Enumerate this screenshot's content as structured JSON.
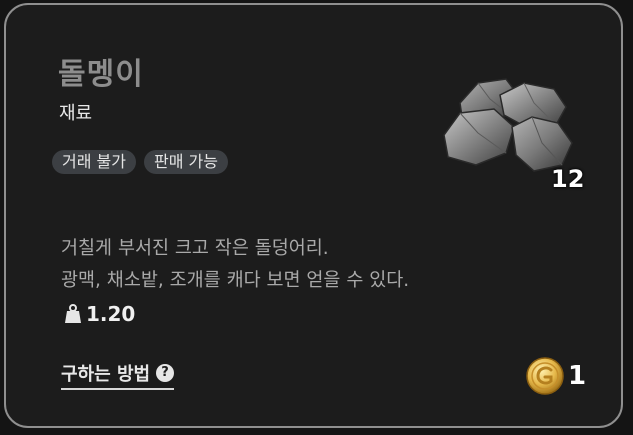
{
  "item": {
    "name": "돌멩이",
    "category": "재료",
    "tags": [
      "거래 불가",
      "판매 가능"
    ],
    "quantity": "12",
    "description_lines": [
      "거칠게 부서진 크고 작은 돌덩어리.",
      "광맥, 채소밭, 조개를 캐다 보면 얻을 수 있다."
    ],
    "weight": "1.20",
    "weight_icon": "weight-icon",
    "howto_label": "구하는 방법",
    "help_icon": "question-circle-icon",
    "price": "1",
    "price_icon": "gold-coin-icon"
  },
  "colors": {
    "card_bg": "#1c1c1c",
    "card_border": "#8f8f8f",
    "tag_bg": "#3c3f43",
    "title": "#8d8d8d",
    "description": "#a9a9a9",
    "coin": "#e6b84a"
  }
}
